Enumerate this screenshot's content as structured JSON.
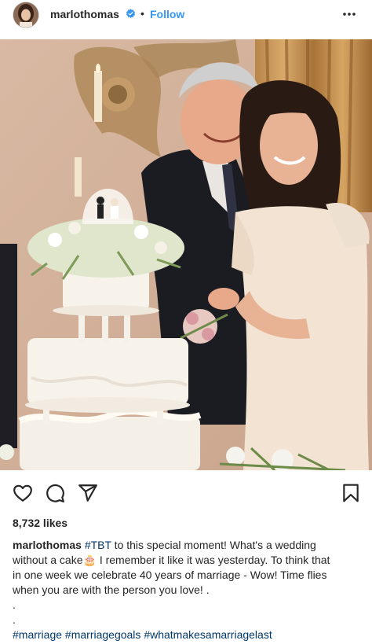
{
  "post": {
    "username": "marlothomas",
    "separator": "•",
    "follow_label": "Follow",
    "likes": "8,732 likes",
    "caption": {
      "username": "marlothomas",
      "hashtag_tbt": "#TBT",
      "text_1": " to this special moment! What's a wedding",
      "text_2": "without a cake",
      "emoji": "🎂",
      "text_3": " I remember it like it was yesterday. To think that",
      "text_4": "in one week we celebrate 40 years of marriage - Wow! Time flies",
      "text_5": "when you are with the person you love! .",
      "dot_1": ".",
      "dot_2": ".",
      "hashtags": [
        "#marriage",
        "#marriagegoals",
        "#whatmakesamarriagelast"
      ]
    }
  },
  "icons": {
    "verified": "verified-badge-icon",
    "more": "more-options-icon",
    "like": "heart-icon",
    "comment": "comment-icon",
    "share": "share-icon",
    "save": "bookmark-icon"
  },
  "colors": {
    "link": "#00376b",
    "follow": "#3897f0",
    "verified": "#3897f0",
    "text": "#262626"
  }
}
